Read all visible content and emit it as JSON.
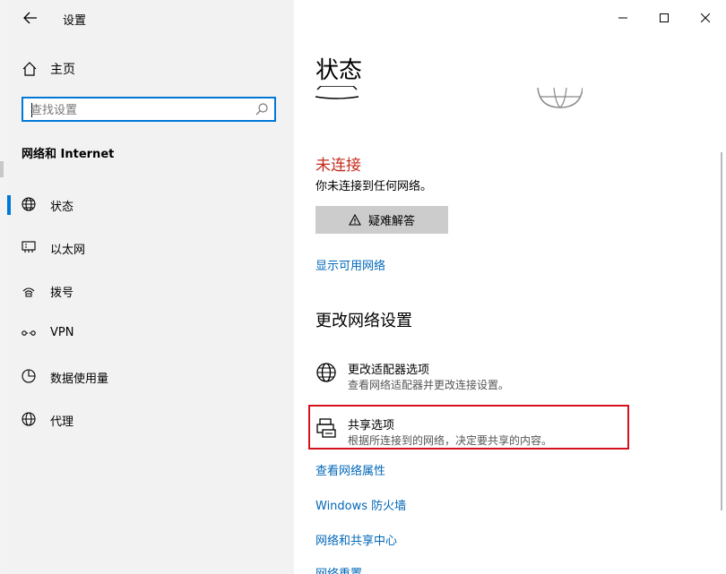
{
  "window": {
    "title": "设置"
  },
  "sidebar": {
    "home_label": "主页",
    "search_placeholder": "查找设置",
    "section_heading": "网络和 Internet",
    "items": [
      {
        "label": "状态",
        "icon": "globe-icon",
        "active": true
      },
      {
        "label": "以太网",
        "icon": "ethernet-icon",
        "active": false
      },
      {
        "label": "拨号",
        "icon": "dialup-icon",
        "active": false
      },
      {
        "label": "VPN",
        "icon": "vpn-icon",
        "active": false
      },
      {
        "label": "数据使用量",
        "icon": "data-usage-icon",
        "active": false
      },
      {
        "label": "代理",
        "icon": "proxy-globe-icon",
        "active": false
      }
    ]
  },
  "main": {
    "page_title": "状态",
    "status_error": "未连接",
    "status_desc": "你未连接到任何网络。",
    "troubleshoot_label": "疑难解答",
    "show_networks_link": "显示可用网络",
    "change_heading": "更改网络设置",
    "options": [
      {
        "title": "更改适配器选项",
        "desc": "查看网络适配器并更改连接设置。",
        "icon": "adapter-globe-icon"
      },
      {
        "title": "共享选项",
        "desc": "根据所连接到的网络，决定要共享的内容。",
        "icon": "sharing-printer-icon"
      }
    ],
    "links": [
      "查看网络属性",
      "Windows 防火墙",
      "网络和共享中心",
      "网络重置"
    ]
  },
  "colors": {
    "accent": "#0078d7",
    "link": "#0067b8",
    "error": "#c42b1c",
    "highlight": "#d5121b"
  }
}
